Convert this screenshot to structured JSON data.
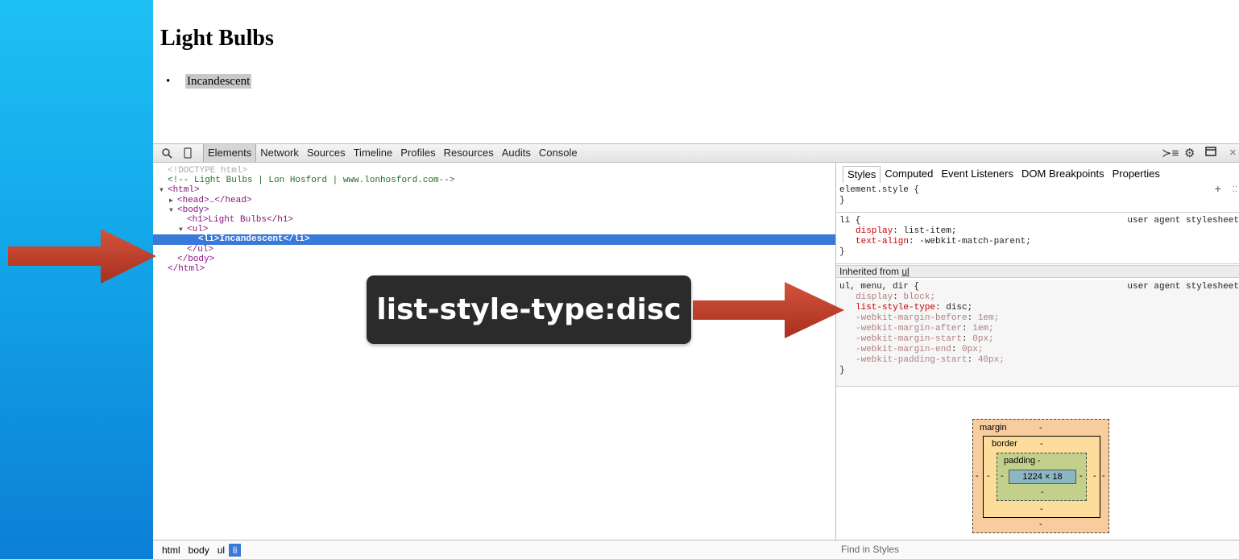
{
  "page": {
    "title": "Light Bulbs",
    "list_item": "Incandescent"
  },
  "toolbar": {
    "tabs": [
      "Elements",
      "Network",
      "Sources",
      "Timeline",
      "Profiles",
      "Resources",
      "Audits",
      "Console"
    ],
    "active_tab": "Elements"
  },
  "dom_tree": {
    "doctype": "<!DOCTYPE html>",
    "comment": "<!-- Light Bulbs | Lon Hosford | www.lonhosford.com-->",
    "html_open": "<html>",
    "head": "<head>…</head>",
    "body_open": "<body>",
    "h1": "<h1>Light Bulbs</h1>",
    "ul_open": "<ul>",
    "li": "<li>Incandescent</li>",
    "ul_close": "</ul>",
    "body_close": "</body>",
    "html_close": "</html>"
  },
  "styles": {
    "tabs": [
      "Styles",
      "Computed",
      "Event Listeners",
      "DOM Breakpoints",
      "Properties"
    ],
    "element_style": "element.style {",
    "close_brace": "}",
    "li_rule": {
      "selector": "li {",
      "origin": "user agent stylesheet",
      "props": [
        {
          "name": "display",
          "value": "list-item;"
        },
        {
          "name": "text-align",
          "value": "-webkit-match-parent;"
        }
      ]
    },
    "inherited_label": "Inherited from ",
    "inherited_from": "ul",
    "ul_rule": {
      "selector": "ul, menu, dir {",
      "origin": "user agent stylesheet",
      "props": [
        {
          "name": "display",
          "value": "block;"
        },
        {
          "name": "list-style-type",
          "value": "disc;"
        },
        {
          "name": "-webkit-margin-before",
          "value": "1em;"
        },
        {
          "name": "-webkit-margin-after",
          "value": "1em;"
        },
        {
          "name": "-webkit-margin-start",
          "value": "0px;"
        },
        {
          "name": "-webkit-margin-end",
          "value": "0px;"
        },
        {
          "name": "-webkit-padding-start",
          "value": "40px;"
        }
      ]
    }
  },
  "box_model": {
    "margin_label": "margin",
    "border_label": "border",
    "padding_label": "padding",
    "dash": "-",
    "content": "1224 × 18"
  },
  "breadcrumbs": [
    "html",
    "body",
    "ul",
    "li"
  ],
  "find_placeholder": "Find in Styles",
  "callout": "list-style-type:disc",
  "colors": {
    "selected_row": "#3879d9",
    "arrow": "#c0392b",
    "background": "#13a9ea"
  }
}
